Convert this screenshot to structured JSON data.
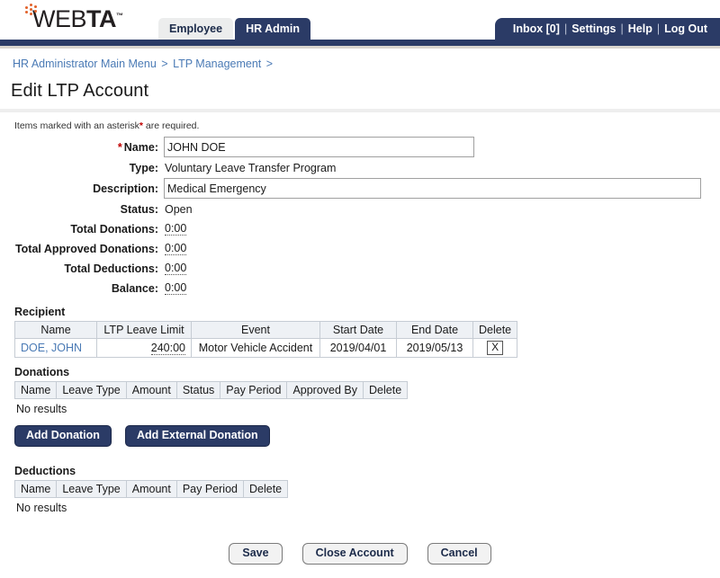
{
  "app": {
    "logo_text_light": "WEB",
    "logo_text_bold": "TA",
    "logo_tm": "™"
  },
  "header": {
    "tabs": [
      {
        "label": "Employee",
        "active": false
      },
      {
        "label": "HR Admin",
        "active": true
      }
    ],
    "utility_links": [
      {
        "label": "Inbox [0]"
      },
      {
        "label": "Settings"
      },
      {
        "label": "Help"
      },
      {
        "label": "Log Out"
      }
    ],
    "separator": "|",
    "accent_navy": "#2b3b66",
    "accent_orange": "#e2622a"
  },
  "breadcrumb": {
    "items": [
      {
        "label": "HR Administrator Main Menu"
      },
      {
        "label": "LTP Management"
      }
    ],
    "separator": ">",
    "trailing_separator": ">",
    "link_color": "#4a7ab5"
  },
  "page": {
    "title": "Edit LTP Account",
    "required_note_prefix": "Items marked with an asterisk",
    "required_note_star": "*",
    "required_note_suffix": " are required."
  },
  "form": {
    "name": {
      "label": "Name:",
      "required_star": "*",
      "value": "JOHN DOE",
      "placeholder": ""
    },
    "type": {
      "label": "Type:",
      "value": "Voluntary Leave Transfer Program"
    },
    "description": {
      "label": "Description:",
      "value": "Medical Emergency",
      "placeholder": ""
    },
    "status": {
      "label": "Status:",
      "value": "Open"
    },
    "total_donations": {
      "label": "Total Donations:",
      "value": "0:00"
    },
    "total_approved_donations": {
      "label": "Total Approved Donations:",
      "value": "0:00"
    },
    "total_deductions": {
      "label": "Total Deductions:",
      "value": "0:00"
    },
    "balance": {
      "label": "Balance:",
      "value": "0:00"
    }
  },
  "recipient": {
    "title": "Recipient",
    "columns": [
      "Name",
      "LTP Leave Limit",
      "Event",
      "Start Date",
      "End Date",
      "Delete"
    ],
    "rows": [
      {
        "name": "DOE, JOHN",
        "ltp_leave_limit": "240:00",
        "event": "Motor Vehicle Accident",
        "start_date": "2019/04/01",
        "end_date": "2019/05/13",
        "delete": "X"
      }
    ]
  },
  "donations": {
    "title": "Donations",
    "columns": [
      "Name",
      "Leave Type",
      "Amount",
      "Status",
      "Pay Period",
      "Approved By",
      "Delete"
    ],
    "empty_text": "No results",
    "buttons": [
      {
        "label": "Add Donation"
      },
      {
        "label": "Add External Donation"
      }
    ]
  },
  "deductions": {
    "title": "Deductions",
    "columns": [
      "Name",
      "Leave Type",
      "Amount",
      "Pay Period",
      "Delete"
    ],
    "empty_text": "No results"
  },
  "footer": {
    "buttons": [
      {
        "label": "Save"
      },
      {
        "label": "Close Account"
      },
      {
        "label": "Cancel"
      }
    ]
  }
}
